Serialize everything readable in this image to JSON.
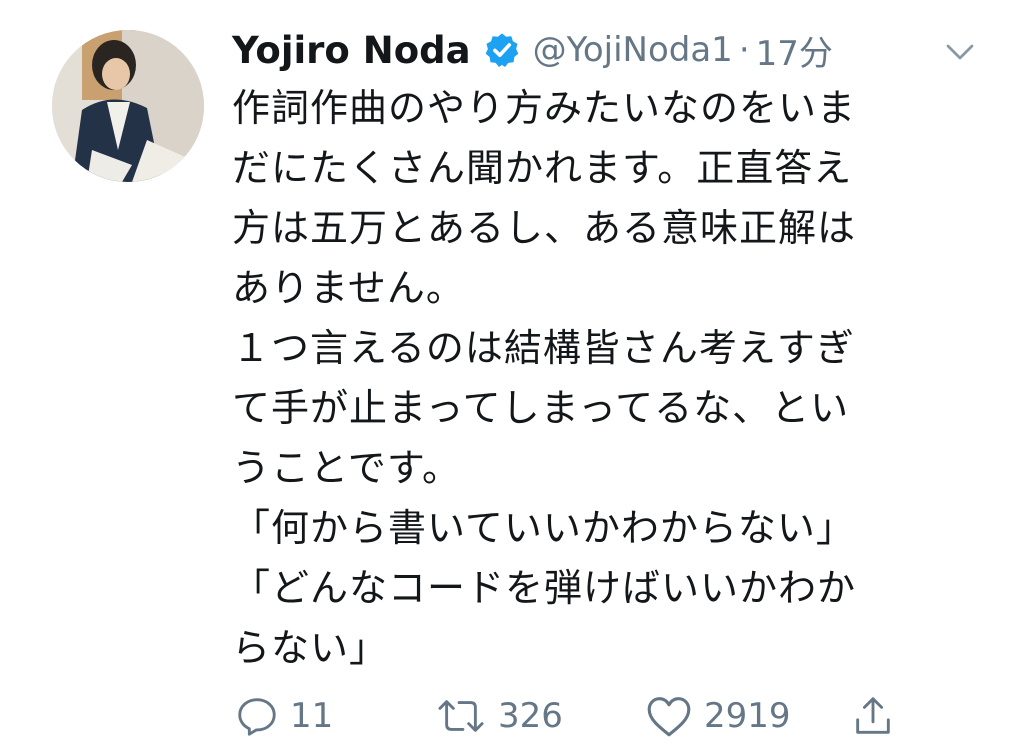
{
  "tweet": {
    "author_name": "Yojiro Noda",
    "handle": "@YojiNoda1",
    "separator": "·",
    "time": "17分",
    "body_lines": [
      "作詞作曲のやり方みたいなのをいま",
      "だにたくさん聞かれます。正直答え",
      "方は五万とあるし、ある意味正解は",
      "ありません。",
      "１つ言えるのは結構皆さん考えすぎ",
      "て手が止まってしまってるな、とい",
      "うことです。",
      "「何から書いていいかわからない」",
      "「どんなコードを弾けばいいかわか",
      "らない」"
    ],
    "actions": {
      "reply_count": "11",
      "retweet_count": "326",
      "like_count": "2919"
    }
  },
  "colors": {
    "text": "#14171a",
    "secondary": "#657786",
    "verified": "#1da1f2"
  },
  "icons": [
    "avatar",
    "verified-badge-icon",
    "chevron-down-icon",
    "reply-icon",
    "retweet-icon",
    "like-icon",
    "share-icon"
  ]
}
